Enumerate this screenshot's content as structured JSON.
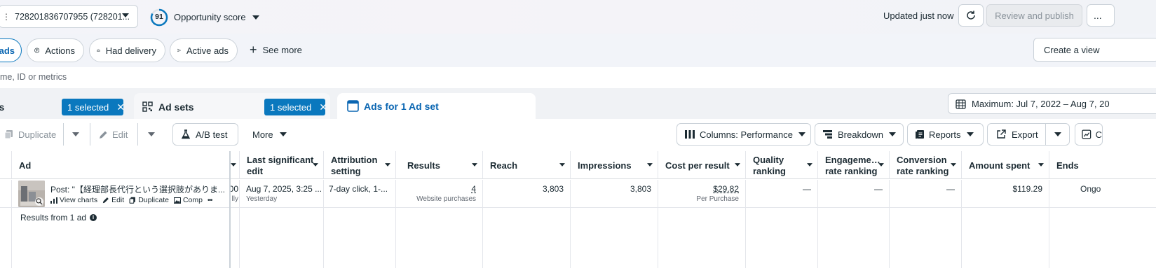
{
  "topbar": {
    "account": "728201836707955 (728201...",
    "opportunity_score": "91",
    "opportunity_label": "Opportunity score",
    "updated": "Updated just now",
    "review_publish": "Review and publish",
    "more": "..."
  },
  "filters": {
    "ads_pill": "ads",
    "actions": "Actions",
    "had_delivery": "Had delivery",
    "active_ads": "Active ads",
    "see_more": "See more",
    "create_view": "Create a view"
  },
  "search": {
    "placeholder": "me, ID or metrics"
  },
  "tabs": {
    "campaigns_label": "ns",
    "campaigns_selected": "1 selected",
    "adsets_label": "Ad sets",
    "adsets_selected": "1 selected",
    "ads_label": "Ads for 1 Ad set",
    "date_range": "Maximum: Jul 7, 2022 – Aug 7, 20"
  },
  "toolbar": {
    "duplicate": "Duplicate",
    "edit": "Edit",
    "ab_test": "A/B test",
    "more": "More",
    "columns": "Columns: Performance",
    "breakdown": "Breakdown",
    "reports": "Reports",
    "export": "Export",
    "chart_partial": "C"
  },
  "table": {
    "headers": {
      "ad": "Ad",
      "last_sig_1": "Last significant",
      "last_sig_2": "edit",
      "attr_1": "Attribution",
      "attr_2": "setting",
      "results": "Results",
      "reach": "Reach",
      "impressions": "Impressions",
      "cost_per_result": "Cost per result",
      "quality_1": "Quality",
      "quality_2": "ranking",
      "engage_1": "Engageme…",
      "engage_2": "rate ranking",
      "conv_1": "Conversion",
      "conv_2": "rate ranking",
      "amount_spent": "Amount spent",
      "ends": "Ends"
    },
    "row": {
      "ad_name": "Post: \"【経理部長代行という選択肢がありま...",
      "links": {
        "view_charts": "View charts",
        "edit": "Edit",
        "duplicate": "Duplicate",
        "compare": "Comp",
        "more": "•••"
      },
      "partial_col": "00",
      "partial_col_sub": "lly",
      "last_edit": "Aug 7, 2025, 3:25 ...",
      "last_edit_sub": "Yesterday",
      "attribution": "7-day click, 1-...",
      "results": "4",
      "results_sub": "Website purchases",
      "reach": "3,803",
      "impressions": "3,803",
      "cost_per_result": "$29.82",
      "cost_sub": "Per Purchase",
      "quality": "—",
      "engagement": "—",
      "conversion": "—",
      "amount_spent": "$119.29",
      "ends": "Ongo"
    },
    "summary": "Results from 1 ad"
  }
}
